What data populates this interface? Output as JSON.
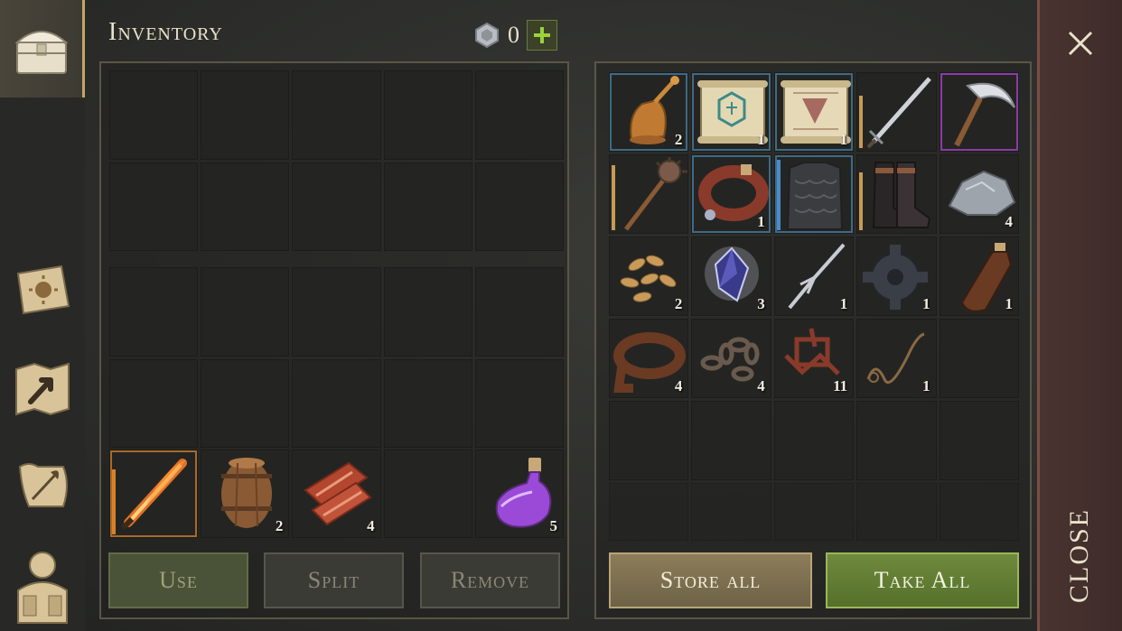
{
  "header": {
    "title": "Inventory",
    "currency_value": "0"
  },
  "player_inventory": {
    "hotbar": [
      {
        "icon": "flaming-sword-icon",
        "qty": "",
        "rarity": "orange",
        "durability": 0.85
      },
      {
        "icon": "wooden-barrel-icon",
        "qty": "2"
      },
      {
        "icon": "raw-meat-icon",
        "qty": "4"
      },
      {
        "icon": "",
        "qty": ""
      },
      {
        "icon": "purple-potion-icon",
        "qty": "5"
      }
    ]
  },
  "actions_left": {
    "use": "Use",
    "split": "Split",
    "remove": "Remove"
  },
  "storage": {
    "rows": [
      [
        {
          "icon": "bronze-bell-icon",
          "qty": "2",
          "rarity": "blue"
        },
        {
          "icon": "blue-scroll-icon",
          "qty": "1",
          "rarity": "blue"
        },
        {
          "icon": "red-scroll-icon",
          "qty": "1",
          "rarity": "blue"
        },
        {
          "icon": "long-sword-icon",
          "qty": "",
          "durability": 0.7
        },
        {
          "icon": "scythe-icon",
          "qty": "",
          "rarity": "purple"
        }
      ],
      [
        {
          "icon": "mace-icon",
          "qty": "",
          "durability": 0.8
        },
        {
          "icon": "leather-collar-icon",
          "qty": "1",
          "rarity": "blue"
        },
        {
          "icon": "scale-armor-icon",
          "qty": "",
          "rarity": "blue-left",
          "durability": 0.9
        },
        {
          "icon": "leather-boots-icon",
          "qty": "",
          "durability": 0.75
        },
        {
          "icon": "stone-ore-icon",
          "qty": "4"
        }
      ],
      [
        {
          "icon": "seeds-icon",
          "qty": "2"
        },
        {
          "icon": "crystal-shard-icon",
          "qty": "3"
        },
        {
          "icon": "hook-tool-icon",
          "qty": "1"
        },
        {
          "icon": "gear-icon",
          "qty": "1"
        },
        {
          "icon": "leather-flask-icon",
          "qty": "1"
        }
      ],
      [
        {
          "icon": "leather-strap-icon",
          "qty": "4"
        },
        {
          "icon": "chain-icon",
          "qty": "4"
        },
        {
          "icon": "copper-scrap-icon",
          "qty": "11"
        },
        {
          "icon": "rope-icon",
          "qty": "1"
        },
        {
          "icon": "",
          "qty": ""
        }
      ]
    ]
  },
  "actions_right": {
    "store_all": "Store all",
    "take_all": "Take All"
  },
  "close": {
    "label": "CLOSE"
  },
  "colors": {
    "accent_green": "#6f8a3d",
    "accent_tan": "#8c7d5a",
    "rarity_blue": "#3e6a86",
    "rarity_purple": "#8d3aa8",
    "rarity_orange": "#a86a2a",
    "close_red": "#4a3330"
  }
}
